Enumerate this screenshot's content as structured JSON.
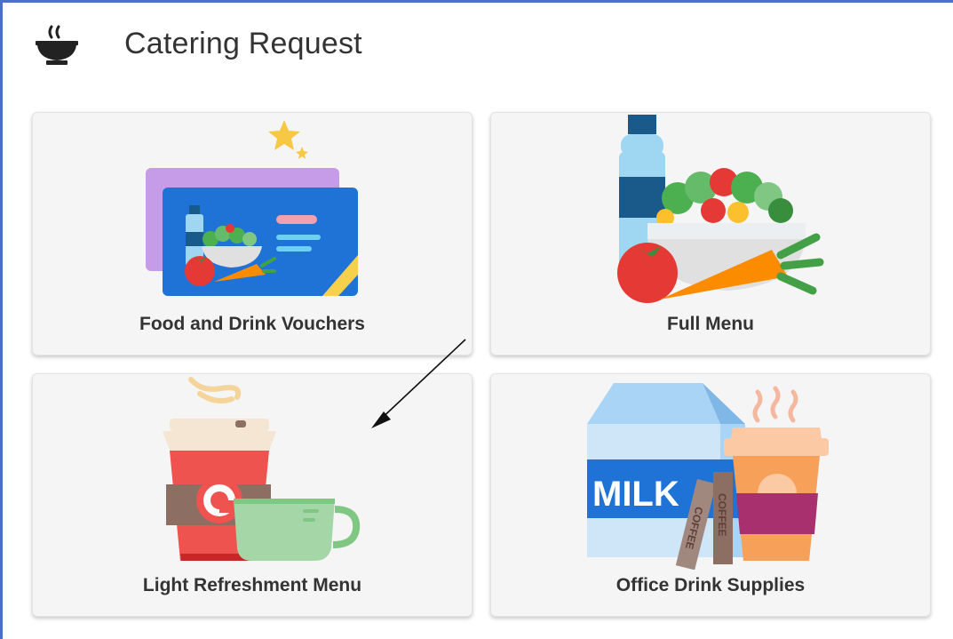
{
  "header": {
    "title": "Catering Request",
    "icon": "bowl-icon"
  },
  "tiles": [
    {
      "label": "Food and Drink Vouchers",
      "icon": "voucher-card-icon"
    },
    {
      "label": "Full Menu",
      "icon": "salad-bottle-icon"
    },
    {
      "label": "Light Refreshment Menu",
      "icon": "coffee-cup-icon"
    },
    {
      "label": "Office Drink Supplies",
      "icon": "milk-carton-icon",
      "carton_text": "MILK",
      "stick_text": "COFFEE"
    }
  ],
  "colors": {
    "frame_border": "#4a72c4",
    "tile_background": "#f5f5f5",
    "text": "#333333"
  }
}
